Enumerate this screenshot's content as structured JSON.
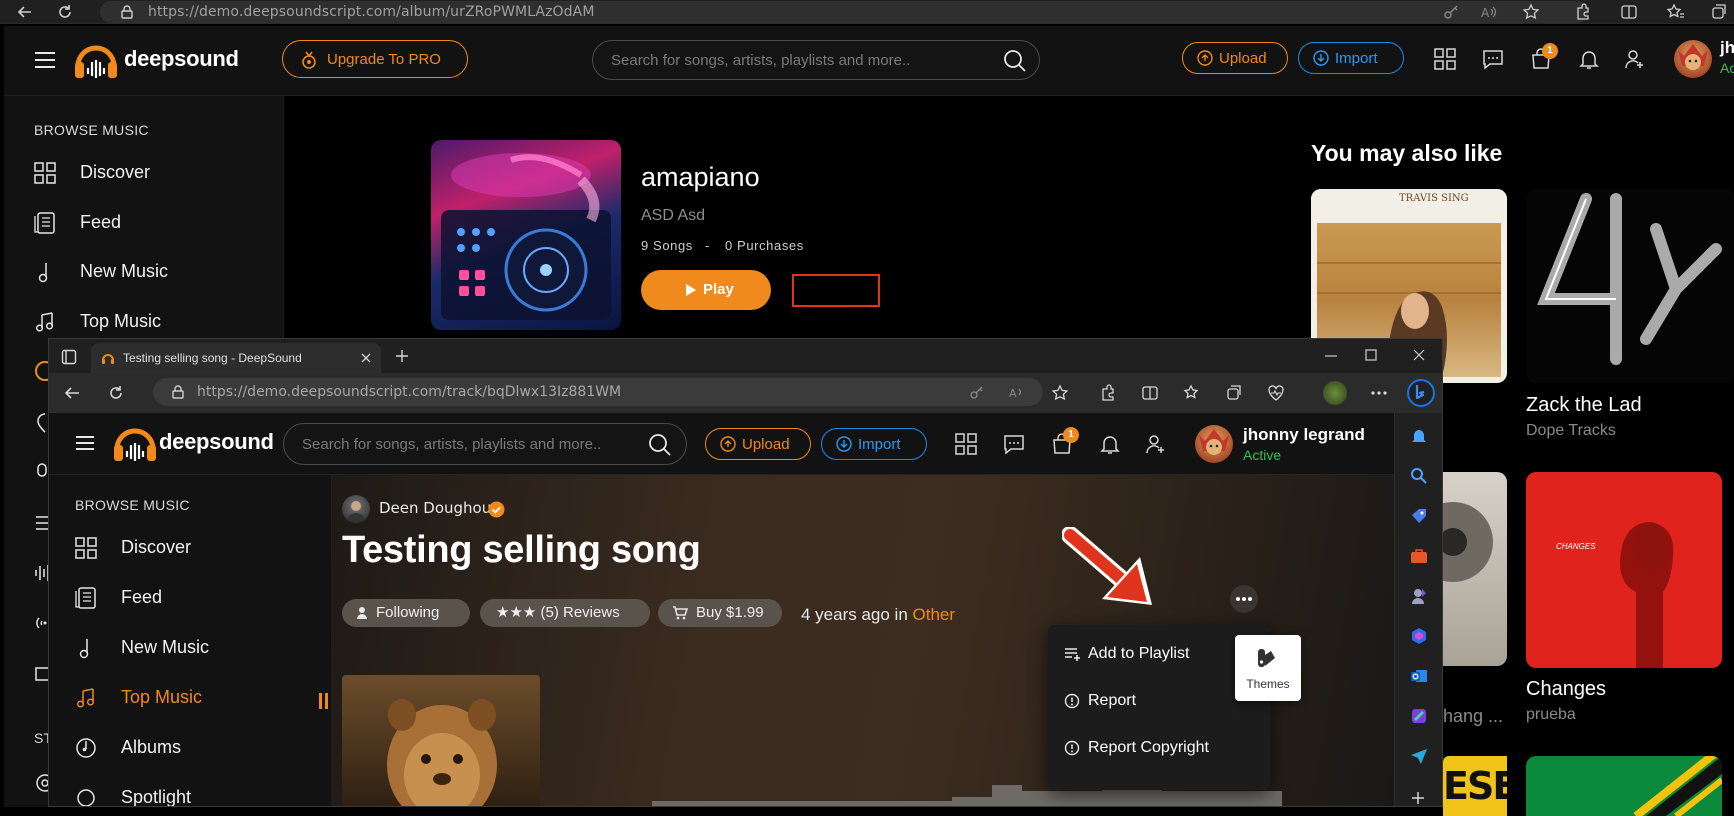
{
  "outer_browser": {
    "url": "https://demo.deepsoundscript.com/album/urZRoPWMLAzOdAM"
  },
  "outer_app": {
    "logo": "deepsound",
    "upgrade_label": "Upgrade To PRO",
    "search_placeholder": "Search for songs, artists, playlists and more..",
    "upload_label": "Upload",
    "import_label": "Import",
    "cart_badge": "1",
    "user_initials": "jh",
    "user_status": "Ac",
    "sidebar": {
      "heading": "BROWSE MUSIC",
      "items": [
        {
          "label": "Discover",
          "icon": "grid-icon"
        },
        {
          "label": "Feed",
          "icon": "feed-icon"
        },
        {
          "label": "New Music",
          "icon": "music-note-icon"
        },
        {
          "label": "Top Music",
          "icon": "music-notes-icon"
        }
      ],
      "footer_heading": "ST"
    },
    "album": {
      "title": "amapiano",
      "artist": "ASD Asd",
      "songs": "9 Songs",
      "separator": "-",
      "purchases": "0 Purchases",
      "play_label": "Play"
    },
    "also_like": {
      "heading": "You may also like",
      "items": [
        {
          "title": "",
          "subtitle": "",
          "cover_text": "TRAVIS SING"
        },
        {
          "title": "Zack the Lad",
          "subtitle": "Dope Tracks"
        },
        {
          "title": "hang ...",
          "subtitle": ""
        },
        {
          "title": "Changes",
          "subtitle": "prueba",
          "cover_text": "CHANGES"
        }
      ],
      "partial_text": "ESE"
    }
  },
  "inner_browser": {
    "tab_title": "Testing selling song - DeepSound",
    "url": "https://demo.deepsoundscript.com/track/bqDlwx13Iz881WM"
  },
  "inner_app": {
    "logo": "deepsound",
    "search_placeholder": "Search for songs, artists, playlists and more..",
    "upload_label": "Upload",
    "import_label": "Import",
    "cart_badge": "1",
    "user_name": "jhonny legrand",
    "user_status": "Active",
    "sidebar": {
      "heading": "BROWSE MUSIC",
      "items": [
        {
          "label": "Discover",
          "icon": "grid-icon"
        },
        {
          "label": "Feed",
          "icon": "feed-icon"
        },
        {
          "label": "New Music",
          "icon": "music-note-icon"
        },
        {
          "label": "Top Music",
          "icon": "music-notes-icon",
          "active": true
        },
        {
          "label": "Albums",
          "icon": "album-icon"
        },
        {
          "label": "Spotlight",
          "icon": "spotlight-icon"
        }
      ]
    },
    "track": {
      "artist": "Deen Doughouz",
      "title": "Testing selling song",
      "following_label": "Following",
      "reviews_label": "★★★ (5) Reviews",
      "buy_label": "Buy $1.99",
      "time_ago": "4 years ago in",
      "category": "Other"
    },
    "menu": {
      "items": [
        "Add to Playlist",
        "Report",
        "Report Copyright"
      ]
    },
    "themes_label": "Themes"
  },
  "colors": {
    "accent": "#f08a1c",
    "blue": "#1f8ae6",
    "active_green": "#2ec45b"
  }
}
